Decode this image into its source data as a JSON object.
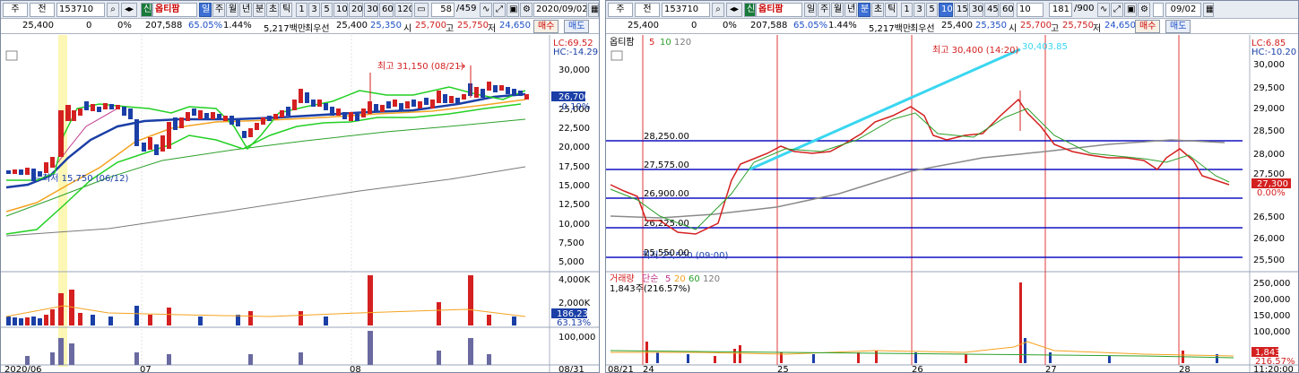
{
  "left": {
    "toolbar": {
      "tab": "주",
      "mode": "전",
      "code": "153710",
      "tag": "신",
      "name": "옵티팜",
      "periods": [
        "일",
        "주",
        "월",
        "년",
        "분",
        "초",
        "틱"
      ],
      "nums": [
        "1",
        "3",
        "5",
        "10",
        "20",
        "30",
        "60",
        "120"
      ],
      "count": "58",
      "total": "/459",
      "date": "2020/09/02"
    },
    "quote": {
      "price": "25,400",
      "change": "0",
      "pct": "0%",
      "volume": "207,588",
      "ratio": "65.05%",
      "turnover": "1.44%",
      "amount": "5,217백만",
      "pref": "최우선",
      "bid1": "25,400",
      "bid2": "25,350",
      "open_l": "시",
      "open": "25,700",
      "high_l": "고",
      "high": "25,750",
      "low_l": "저",
      "low": "24,650",
      "buy": "매수",
      "sell": "매도"
    },
    "chart": {
      "lc": "LC:69.52",
      "hc": "HC:-14.29",
      "high_note": "최고 31,150 (08/21)",
      "low_note": "최저 15,750 (06/12)",
      "cur_price": "26,700",
      "cur_pct": "-0.19%",
      "yticks": [
        "30,000",
        "27,500",
        "25,000",
        "22,500",
        "20,000",
        "17,500",
        "15,000",
        "12,500",
        "10,000",
        "7,500",
        "5,000"
      ],
      "vol_ticks": [
        "4,000K",
        "2,000K"
      ],
      "vol_box": "186,232",
      "vol_pct": "63.13%",
      "sub_tick": "100,000",
      "xlabels": [
        "2020/06",
        "07",
        "08",
        "08/31"
      ]
    }
  },
  "right": {
    "toolbar": {
      "tab": "주",
      "mode": "전",
      "code": "153710",
      "tag": "신",
      "name": "옵티팜",
      "periods": [
        "일",
        "주",
        "월",
        "년",
        "분",
        "초",
        "틱"
      ],
      "nums": [
        "1",
        "3",
        "5",
        "10",
        "15",
        "30",
        "45",
        "60"
      ],
      "unit": "10",
      "count": "181",
      "total": "/900",
      "date": "09/02"
    },
    "quote": {
      "price": "25,400",
      "change": "0",
      "pct": "0%",
      "volume": "207,588",
      "ratio": "65.05%",
      "turnover": "1.44%",
      "amount": "5,217백만",
      "pref": "최우선",
      "bid1": "25,400",
      "bid2": "25,350",
      "open_l": "시",
      "open": "25,700",
      "high_l": "고",
      "high": "25,750",
      "low_l": "저",
      "low": "24,650",
      "buy": "매수",
      "sell": "매도"
    },
    "chart": {
      "legend": "옵티팜",
      "ma": [
        "5",
        "10",
        "120"
      ],
      "lc": "LC:6.85",
      "hc": "HC:-10.20",
      "high_note": "최고 30,400 (14:20)",
      "trend_note": "30,403.85",
      "low_note": "최저 25,550 (09:00)",
      "low_lbl": "25,550.00",
      "hlines": [
        "28,250.00",
        "27,575.00",
        "26,900.00",
        "26,225.00"
      ],
      "cur_price": "27,300",
      "cur_pct": "0.00%",
      "yticks": [
        "30,000",
        "29,500",
        "29,000",
        "28,500",
        "28,000",
        "27,500",
        "27,000",
        "26,500",
        "26,000",
        "25,500"
      ],
      "vol_legend": "거래량",
      "vol_ma": "단순",
      "vol_ma_vals": [
        "5",
        "20",
        "60",
        "120"
      ],
      "vol_info": "1,843주(216.57%)",
      "vol_ticks": [
        "250,000",
        "200,000",
        "150,000",
        "100,000",
        "50,000"
      ],
      "vol_box": "1,843",
      "vol_pct": "216.57%",
      "xlabels": [
        "08/21",
        "24",
        "25",
        "26",
        "27",
        "28",
        "11:20:00"
      ]
    }
  }
}
